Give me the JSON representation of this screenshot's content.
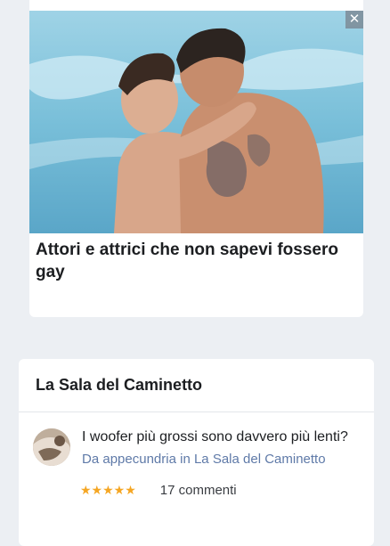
{
  "ad": {
    "close_symbol": "✕",
    "title": "Attori e attrici che non sapevi fossero gay"
  },
  "forum": {
    "section_title": "La Sala del Caminetto",
    "thread": {
      "title": "I woofer più grossi sono davvero più lenti?",
      "by_label": "Da",
      "author": "appecundria",
      "in_label": "in",
      "forum_name": "La Sala del Caminetto",
      "rating_stars": "★★★★★",
      "rating": 5,
      "comments": "17 commenti"
    }
  },
  "colors": {
    "background": "#eceff3",
    "link": "#5f7aa8",
    "star": "#f5a623"
  }
}
